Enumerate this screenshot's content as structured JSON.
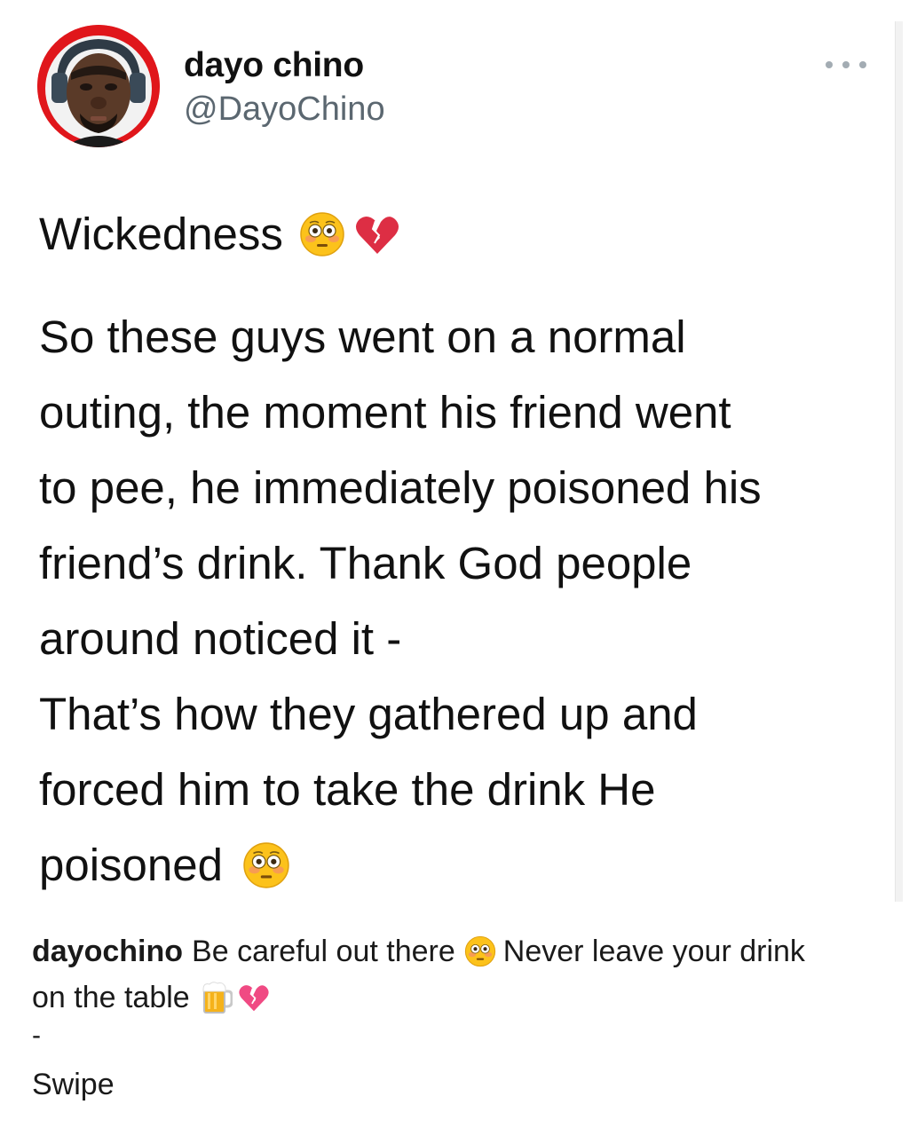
{
  "tweet": {
    "author_name": "dayo chino",
    "author_handle": "@DayoChino",
    "headline": "Wickedness",
    "body_lines": [
      "So these guys  went on a normal",
      "outing, the moment his friend  went",
      "to pee, he  immediately poisoned his",
      "friend’s drink. Thank God  people",
      "around noticed it -",
      "That’s how they  gathered up and",
      "forced him to take the drink He",
      "poisoned"
    ],
    "headline_emojis": [
      "flushed-face-emoji",
      "broken-heart-emoji"
    ],
    "end_emoji": "flushed-face-emoji"
  },
  "caption": {
    "username": "dayochino",
    "text_part1": "Be careful out there",
    "text_part2": "Never leave your drink",
    "text_part3": "on the table",
    "emojis": [
      "flushed-face-emoji",
      "beer-mug-emoji",
      "broken-heart-emoji"
    ]
  },
  "dash": "-",
  "swipe": "Swipe",
  "colors": {
    "avatar_ring": "#e0161b",
    "handle_gray": "#5b6770",
    "more_dots": "#a3acb3",
    "broken_heart": "#e0245e",
    "caption_heart": "#f04a83"
  }
}
